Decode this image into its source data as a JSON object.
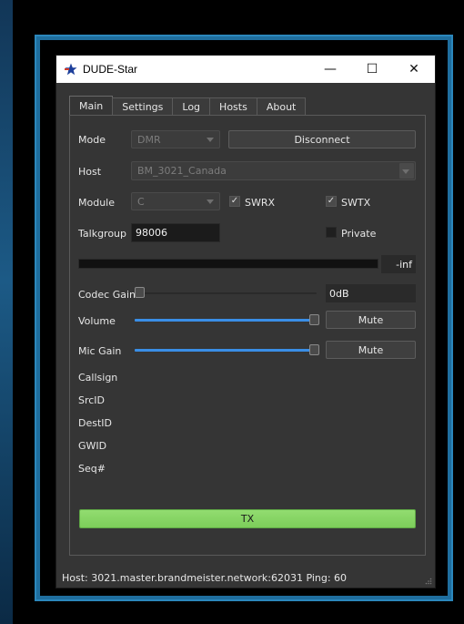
{
  "window": {
    "title": "DUDE-Star",
    "minimize_glyph": "—",
    "maximize_glyph": "☐",
    "close_glyph": "✕",
    "app_icon": "star-icon"
  },
  "tabs": [
    {
      "label": "Main",
      "active": true
    },
    {
      "label": "Settings",
      "active": false
    },
    {
      "label": "Log",
      "active": false
    },
    {
      "label": "Hosts",
      "active": false
    },
    {
      "label": "About",
      "active": false
    }
  ],
  "main": {
    "mode": {
      "label": "Mode",
      "value": "DMR"
    },
    "disconnect_label": "Disconnect",
    "host": {
      "label": "Host",
      "value": "BM_3021_Canada"
    },
    "module": {
      "label": "Module",
      "value": "C"
    },
    "swrx": {
      "label": "SWRX",
      "checked": true
    },
    "swtx": {
      "label": "SWTX",
      "checked": true
    },
    "talkgroup": {
      "label": "Talkgroup",
      "value": "98006"
    },
    "private": {
      "label": "Private",
      "checked": false
    },
    "level_meter": {
      "readout": "-inf",
      "fill": 0
    },
    "codec_gain": {
      "label": "Codec Gain",
      "readout": "0dB",
      "level": 0
    },
    "volume": {
      "label": "Volume",
      "level": 1.0,
      "mute_label": "Mute"
    },
    "mic_gain": {
      "label": "Mic Gain",
      "level": 1.0,
      "mute_label": "Mute"
    },
    "info_labels": [
      "Callsign",
      "SrcID",
      "DestID",
      "GWID",
      "Seq#"
    ],
    "tx_label": "TX"
  },
  "status": {
    "text": "Host: 3021.master.brandmeister.network:62031 Ping: 60"
  },
  "colors": {
    "accent_blue": "#3a8ee6",
    "tx_green": "#86d464",
    "window_bg": "#353535",
    "frame_blue": "#1f6e9e"
  }
}
